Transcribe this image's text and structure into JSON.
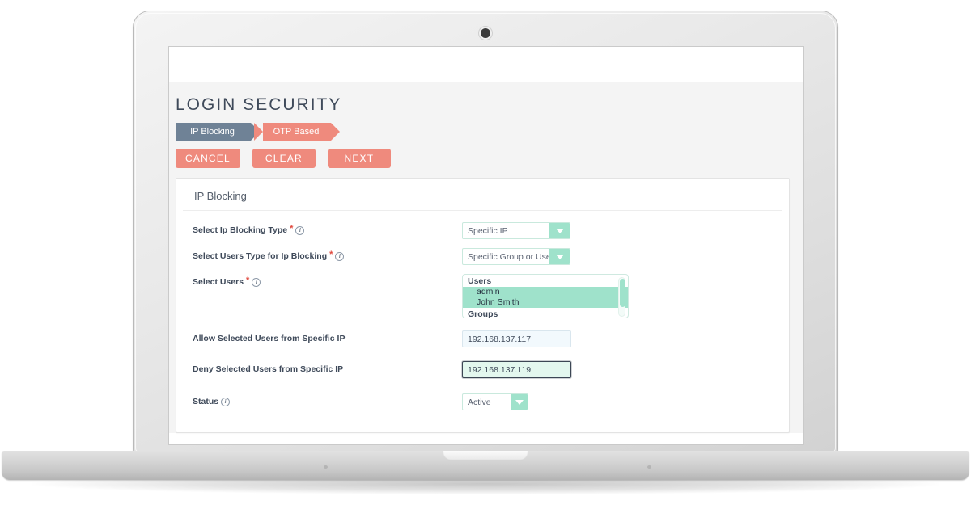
{
  "page": {
    "title": "LOGIN SECURITY"
  },
  "steps": [
    {
      "label": "IP Blocking",
      "state": "active"
    },
    {
      "label": "OTP Based",
      "state": "next"
    }
  ],
  "actions": [
    {
      "label": "CANCEL",
      "name": "cancel-button"
    },
    {
      "label": "CLEAR",
      "name": "clear-button"
    },
    {
      "label": "NEXT",
      "name": "next-button"
    }
  ],
  "card": {
    "heading": "IP Blocking",
    "fields": {
      "blocking_type": {
        "label": "Select Ip Blocking Type",
        "required": "*",
        "info": "i",
        "value": "Specific IP"
      },
      "users_type": {
        "label": "Select Users Type for Ip Blocking",
        "required": "*",
        "info": "i",
        "value": "Specific Group or Users"
      },
      "select_users": {
        "label": "Select Users",
        "required": "*",
        "info": "i",
        "options": [
          {
            "text": "Users",
            "type": "group",
            "selected": false
          },
          {
            "text": "admin",
            "type": "option",
            "selected": true
          },
          {
            "text": "John Smith",
            "type": "option",
            "selected": true
          },
          {
            "text": "Groups",
            "type": "group",
            "selected": false
          }
        ]
      },
      "allow_ip": {
        "label": "Allow Selected Users from Specific IP",
        "value": "192.168.137.117",
        "placeholder": ""
      },
      "deny_ip": {
        "label": "Deny Selected Users from Specific IP",
        "value": "192.168.137.119",
        "placeholder": "",
        "focused": true
      },
      "status": {
        "label": "Status",
        "info": "i",
        "value": "Active"
      }
    }
  },
  "colors": {
    "accent_salmon": "#ef8a7d",
    "step_active_gray": "#6f8296",
    "mint": "#9fe2cb",
    "title_text": "#3f4a5a"
  }
}
